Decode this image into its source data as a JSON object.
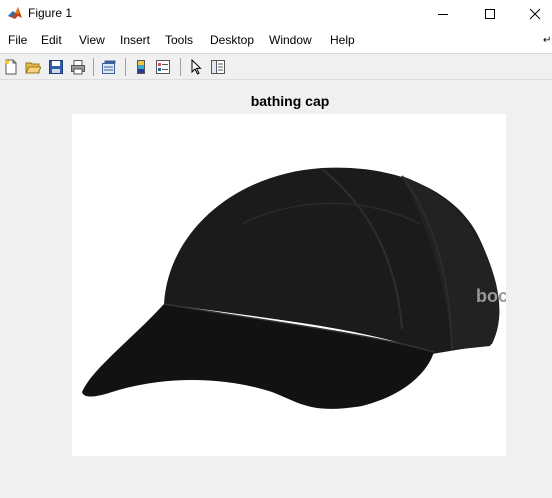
{
  "window": {
    "title": "Figure 1",
    "app_icon": "matlab-logo-icon",
    "buttons": [
      "minimize-icon",
      "maximize-icon",
      "close-icon"
    ]
  },
  "menu": {
    "items": [
      "File",
      "Edit",
      "View",
      "Insert",
      "Tools",
      "Desktop",
      "Window",
      "Help"
    ]
  },
  "toolbar": {
    "buttons": [
      "new-figure-icon",
      "open-file-icon",
      "save-icon",
      "print-icon",
      "link-plot-icon",
      "insert-colorbar-icon",
      "insert-legend-icon",
      "edit-plot-cursor-icon",
      "property-inspector-icon"
    ]
  },
  "axes": {
    "title": "bathing cap"
  },
  "image": {
    "subject": "black baseball cap",
    "background_color": "#ffffff",
    "cap_color": "#1a1a1a",
    "logo_text": "boco"
  }
}
